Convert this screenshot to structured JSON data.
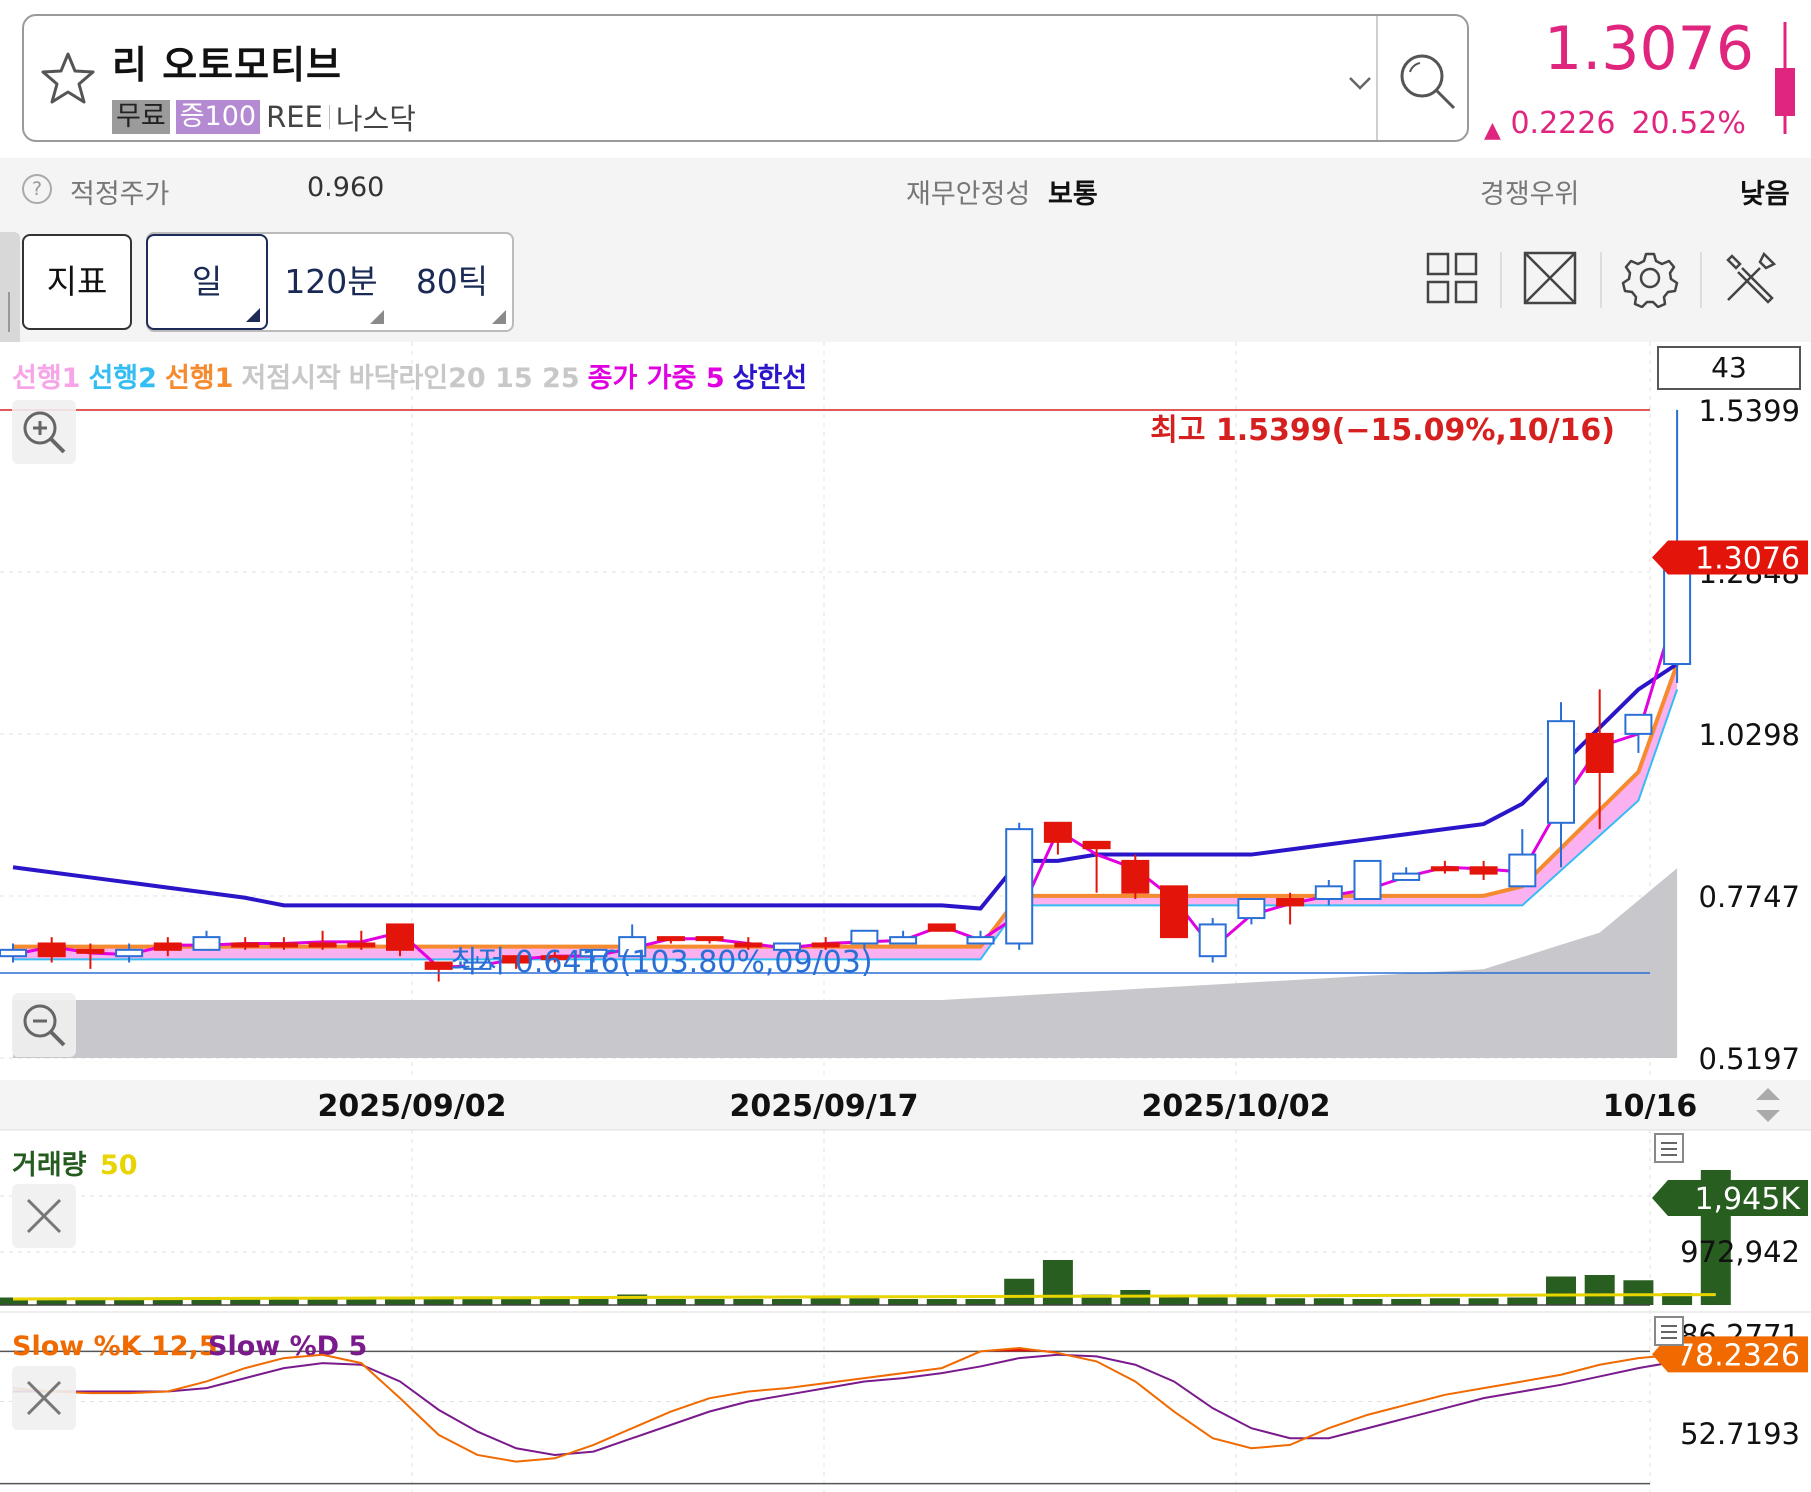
{
  "header": {
    "stock_name": "리 오토모티브",
    "tags": [
      "무료",
      "증100",
      "REE",
      "나스닥"
    ],
    "price": "1.3076",
    "change_abs": "0.2226",
    "change_pct": "20.52%",
    "up_color": "#e0257f"
  },
  "info_bar": {
    "fair_price_label": "적정주가",
    "fair_price_value": "0.960",
    "stability_label": "재무안정성",
    "stability_value": "보통",
    "competitive_label": "경쟁우위",
    "competitive_value": "낮음"
  },
  "toolbar": {
    "indicator_label": "지표",
    "periods": [
      "일",
      "120분",
      "80틱"
    ],
    "active_period": "일"
  },
  "legend": [
    {
      "text": "선행1",
      "color": "#f7a4e8"
    },
    {
      "text": "선행2",
      "color": "#33bdf2"
    },
    {
      "text": "선행1",
      "color": "#f58a2e"
    },
    {
      "text": "저점시작",
      "color": "#c8c8c8"
    },
    {
      "text": "바닥라인20 15 25",
      "color": "#c8c8c8"
    },
    {
      "text": "종가 가중 5",
      "color": "#e000e0"
    },
    {
      "text": "상한선",
      "color": "#2a16c8"
    }
  ],
  "bar_count_box": "43",
  "price_axis": [
    "1.5399",
    "1.2848",
    "1.0298",
    "0.7747",
    "0.5197"
  ],
  "current_price_tag": "1.3076",
  "high_annotation": "최고 1.5399(−15.09%,10/16)",
  "low_annotation": "최저 0.6416(103.80%,09/03)",
  "date_axis": [
    "2025/09/02",
    "2025/09/17",
    "2025/10/02",
    "10/16"
  ],
  "volume_pane": {
    "title": "거래량",
    "ma_label": "50",
    "current_tag": "1,945K",
    "axis_label": "972,942"
  },
  "stoch_pane": {
    "k_label": "Slow %K 12,5",
    "d_label": "Slow %D 5",
    "current_tag": "78.2326",
    "axis_label": "52.7193",
    "upper_partial": "86.2771"
  },
  "chart_data": {
    "type": "candlestick",
    "price_range": [
      0.5197,
      1.5399
    ],
    "candles": [
      {
        "o": 0.69,
        "h": 0.7,
        "l": 0.67,
        "c": 0.68
      },
      {
        "o": 0.68,
        "h": 0.71,
        "l": 0.67,
        "c": 0.7
      },
      {
        "o": 0.69,
        "h": 0.7,
        "l": 0.66,
        "c": 0.69
      },
      {
        "o": 0.69,
        "h": 0.7,
        "l": 0.67,
        "c": 0.68
      },
      {
        "o": 0.69,
        "h": 0.71,
        "l": 0.68,
        "c": 0.7
      },
      {
        "o": 0.71,
        "h": 0.72,
        "l": 0.69,
        "c": 0.69
      },
      {
        "o": 0.7,
        "h": 0.71,
        "l": 0.69,
        "c": 0.7
      },
      {
        "o": 0.7,
        "h": 0.71,
        "l": 0.69,
        "c": 0.7
      },
      {
        "o": 0.7,
        "h": 0.72,
        "l": 0.69,
        "c": 0.7
      },
      {
        "o": 0.7,
        "h": 0.72,
        "l": 0.69,
        "c": 0.7
      },
      {
        "o": 0.69,
        "h": 0.73,
        "l": 0.68,
        "c": 0.73
      },
      {
        "o": 0.66,
        "h": 0.67,
        "l": 0.64,
        "c": 0.67
      },
      {
        "o": 0.67,
        "h": 0.68,
        "l": 0.66,
        "c": 0.66
      },
      {
        "o": 0.67,
        "h": 0.68,
        "l": 0.66,
        "c": 0.68
      },
      {
        "o": 0.68,
        "h": 0.69,
        "l": 0.67,
        "c": 0.68
      },
      {
        "o": 0.69,
        "h": 0.69,
        "l": 0.67,
        "c": 0.68
      },
      {
        "o": 0.71,
        "h": 0.73,
        "l": 0.68,
        "c": 0.68
      },
      {
        "o": 0.71,
        "h": 0.71,
        "l": 0.7,
        "c": 0.71
      },
      {
        "o": 0.71,
        "h": 0.71,
        "l": 0.7,
        "c": 0.71
      },
      {
        "o": 0.7,
        "h": 0.71,
        "l": 0.69,
        "c": 0.7
      },
      {
        "o": 0.7,
        "h": 0.7,
        "l": 0.69,
        "c": 0.69
      },
      {
        "o": 0.7,
        "h": 0.71,
        "l": 0.69,
        "c": 0.7
      },
      {
        "o": 0.72,
        "h": 0.72,
        "l": 0.69,
        "c": 0.7
      },
      {
        "o": 0.71,
        "h": 0.72,
        "l": 0.7,
        "c": 0.7
      },
      {
        "o": 0.72,
        "h": 0.73,
        "l": 0.72,
        "c": 0.73
      },
      {
        "o": 0.71,
        "h": 0.72,
        "l": 0.7,
        "c": 0.7
      },
      {
        "o": 0.88,
        "h": 0.89,
        "l": 0.69,
        "c": 0.7
      },
      {
        "o": 0.86,
        "h": 0.89,
        "l": 0.84,
        "c": 0.89
      },
      {
        "o": 0.85,
        "h": 0.86,
        "l": 0.78,
        "c": 0.86
      },
      {
        "o": 0.78,
        "h": 0.84,
        "l": 0.77,
        "c": 0.83
      },
      {
        "o": 0.71,
        "h": 0.79,
        "l": 0.71,
        "c": 0.79
      },
      {
        "o": 0.73,
        "h": 0.74,
        "l": 0.67,
        "c": 0.68
      },
      {
        "o": 0.77,
        "h": 0.77,
        "l": 0.73,
        "c": 0.74
      },
      {
        "o": 0.76,
        "h": 0.78,
        "l": 0.73,
        "c": 0.77
      },
      {
        "o": 0.79,
        "h": 0.8,
        "l": 0.76,
        "c": 0.77
      },
      {
        "o": 0.83,
        "h": 0.83,
        "l": 0.77,
        "c": 0.77
      },
      {
        "o": 0.81,
        "h": 0.82,
        "l": 0.8,
        "c": 0.8
      },
      {
        "o": 0.82,
        "h": 0.83,
        "l": 0.81,
        "c": 0.82
      },
      {
        "o": 0.81,
        "h": 0.83,
        "l": 0.8,
        "c": 0.82
      },
      {
        "o": 0.84,
        "h": 0.88,
        "l": 0.79,
        "c": 0.79
      },
      {
        "o": 1.05,
        "h": 1.08,
        "l": 0.82,
        "c": 0.89
      },
      {
        "o": 0.97,
        "h": 1.1,
        "l": 0.88,
        "c": 1.03
      },
      {
        "o": 1.06,
        "h": 1.06,
        "l": 1.0,
        "c": 1.03
      },
      {
        "o": 1.31,
        "h": 1.54,
        "l": 1.11,
        "c": 1.14
      }
    ],
    "volume": [
      10,
      10,
      8,
      8,
      8,
      9,
      9,
      9,
      9,
      8,
      8,
      8,
      8,
      9,
      9,
      9,
      14,
      8,
      8,
      8,
      8,
      9,
      9,
      8,
      8,
      8,
      35,
      60,
      14,
      20,
      12,
      10,
      10,
      9,
      9,
      8,
      8,
      9,
      9,
      10,
      38,
      40,
      33,
      16,
      180
    ],
    "stoch_k": [
      58,
      56,
      55,
      55,
      56,
      62,
      70,
      76,
      78,
      73,
      52,
      30,
      18,
      14,
      16,
      24,
      34,
      44,
      52,
      56,
      58,
      61,
      64,
      67,
      70,
      80,
      82,
      79,
      74,
      62,
      44,
      28,
      22,
      24,
      34,
      42,
      48,
      54,
      58,
      62,
      66,
      72,
      76,
      78,
      78
    ],
    "stoch_d": [
      56,
      56,
      56,
      56,
      56,
      58,
      64,
      70,
      73,
      72,
      62,
      45,
      32,
      22,
      18,
      20,
      28,
      36,
      44,
      50,
      54,
      58,
      62,
      64,
      67,
      71,
      76,
      78,
      77,
      72,
      62,
      46,
      34,
      28,
      28,
      34,
      40,
      46,
      52,
      56,
      60,
      65,
      70,
      74,
      76
    ]
  }
}
